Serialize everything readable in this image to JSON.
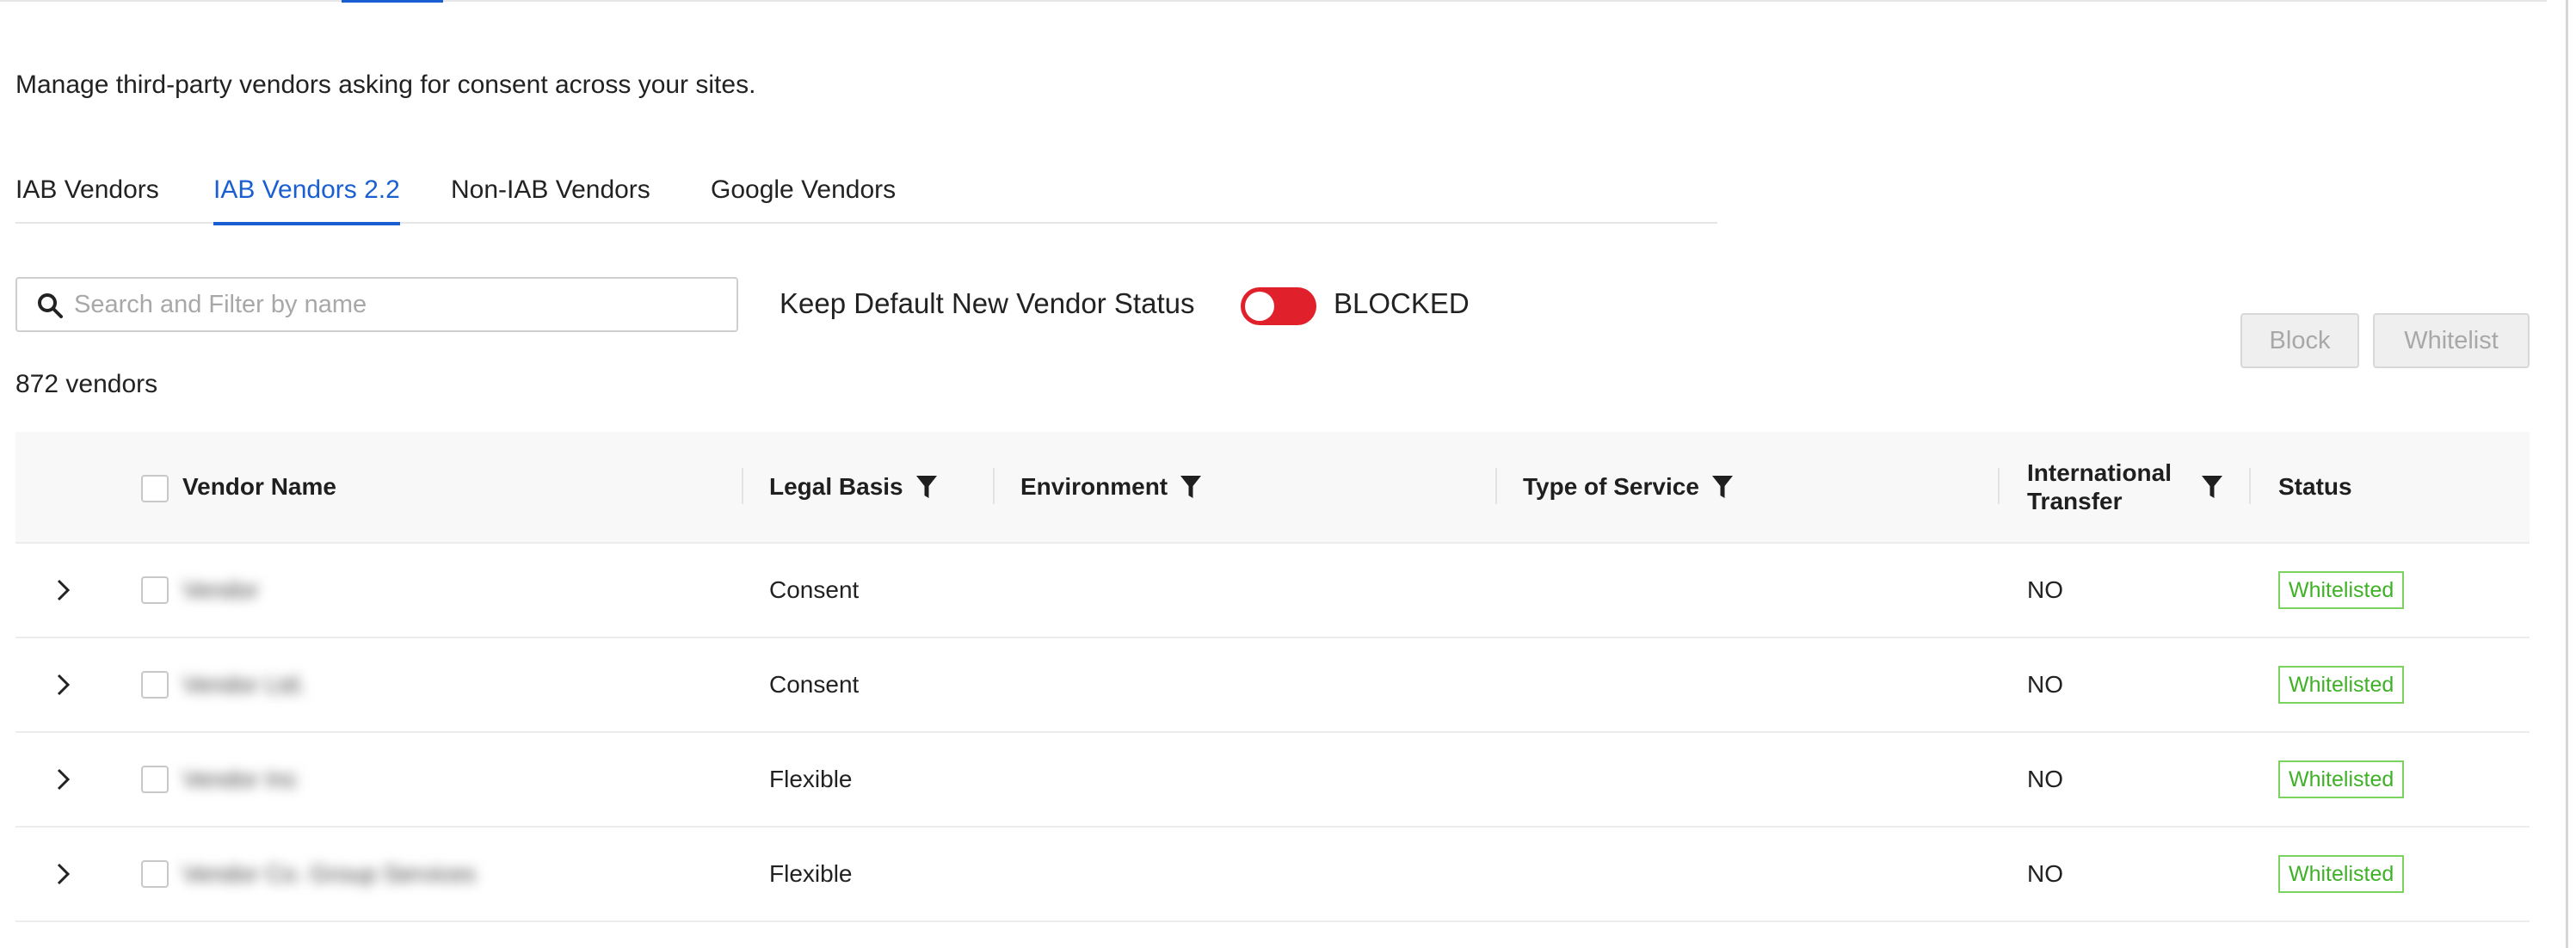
{
  "description": "Manage third-party vendors asking for consent across your sites.",
  "tabs": [
    {
      "label": "IAB Vendors",
      "active": false
    },
    {
      "label": "IAB Vendors 2.2",
      "active": true
    },
    {
      "label": "Non-IAB Vendors",
      "active": false
    },
    {
      "label": "Google Vendors",
      "active": false
    }
  ],
  "search": {
    "placeholder": "Search and Filter by name",
    "value": ""
  },
  "default_status": {
    "label": "Keep Default New Vendor Status",
    "toggle_on": true,
    "value": "BLOCKED"
  },
  "actions": {
    "block_label": "Block",
    "whitelist_label": "Whitelist"
  },
  "vendor_count": "872 vendors",
  "table": {
    "columns": {
      "vendor_name": "Vendor Name",
      "legal_basis": "Legal Basis",
      "environment": "Environment",
      "type_of_service": "Type of Service",
      "international_transfer": [
        "International",
        "Transfer"
      ],
      "status": "Status"
    },
    "rows": [
      {
        "vendor_name": "Vendor",
        "legal_basis": "Consent",
        "environment": "",
        "type_of_service": "",
        "international_transfer": "NO",
        "status": "Whitelisted"
      },
      {
        "vendor_name": "Vendor Ltd.",
        "legal_basis": "Consent",
        "environment": "",
        "type_of_service": "",
        "international_transfer": "NO",
        "status": "Whitelisted"
      },
      {
        "vendor_name": "Vendor Inc",
        "legal_basis": "Flexible",
        "environment": "",
        "type_of_service": "",
        "international_transfer": "NO",
        "status": "Whitelisted"
      },
      {
        "vendor_name": "Vendor Co. Group Services",
        "legal_basis": "Flexible",
        "environment": "",
        "type_of_service": "",
        "international_transfer": "NO",
        "status": "Whitelisted"
      }
    ]
  },
  "colors": {
    "accent": "#1a5fd1",
    "toggle_on": "#e0202a",
    "status_whitelisted": "#3fb127"
  },
  "icons": {
    "search": "magnifier-icon",
    "filter": "funnel-icon",
    "expand": "chevron-right-icon"
  }
}
